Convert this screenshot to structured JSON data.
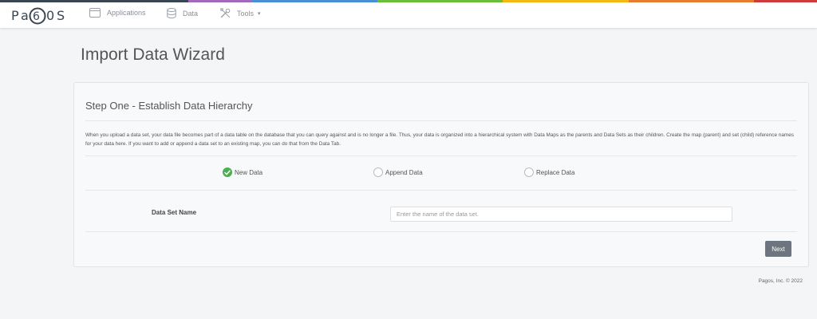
{
  "app": {
    "logo_text": "PAGOS"
  },
  "colors": {
    "topbar": [
      "#3a4652",
      "#3a4652",
      "#3a4652",
      "#a569bd",
      "#4a90d9",
      "#4a90d9",
      "#6abf3b",
      "#6abf3b",
      "#f5b914",
      "#f5b914",
      "#e87e2d",
      "#e87e2d",
      "#d13b3b"
    ],
    "success": "#4caf50",
    "button": "#6d7680"
  },
  "nav": {
    "items": [
      {
        "label": "Applications",
        "icon": "window-icon"
      },
      {
        "label": "Data",
        "icon": "database-icon"
      },
      {
        "label": "Tools",
        "icon": "tools-icon",
        "caret": "▾"
      }
    ]
  },
  "page": {
    "title": "Import Data Wizard"
  },
  "wizard": {
    "step_title": "Step One - Establish Data Hierarchy",
    "description": "When you upload a data set, your data file becomes part of a data table on the database that you can query against and is no longer a file. Thus, your data is organized into a hierarchical system with Data Maps as the parents and Data Sets as their children. Create the map (parent) and set (child) reference names for your data here. If you want to add or append a data set to an existing map, you can do that from the Data Tab.",
    "options": [
      {
        "label": "New Data",
        "selected": true
      },
      {
        "label": "Append Data",
        "selected": false
      },
      {
        "label": "Replace Data",
        "selected": false
      }
    ],
    "field_label": "Data Set Name",
    "field_placeholder": "Enter the name of the data set.",
    "field_value": "",
    "next_label": "Next"
  },
  "footer": {
    "text": "Pagos, Inc. © 2022"
  }
}
